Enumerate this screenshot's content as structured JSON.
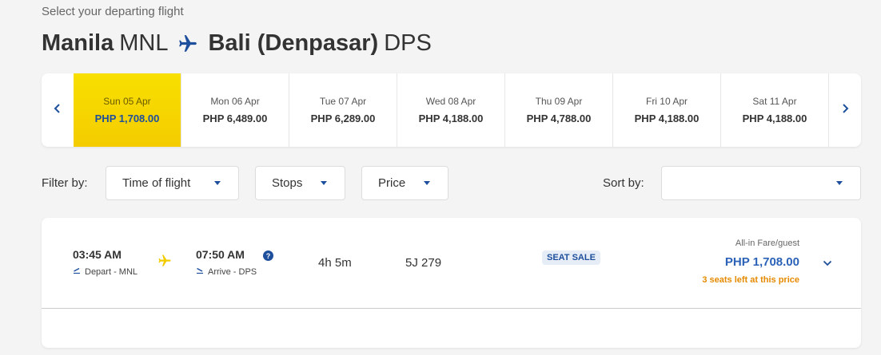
{
  "header": {
    "subtitle": "Select your departing flight",
    "origin_city": "Manila",
    "origin_code": "MNL",
    "dest_city": "Bali (Denpasar)",
    "dest_code": "DPS"
  },
  "dates": [
    {
      "day": "Sun 05 Apr",
      "price": "PHP 1,708.00",
      "selected": true
    },
    {
      "day": "Mon 06 Apr",
      "price": "PHP 6,489.00"
    },
    {
      "day": "Tue 07 Apr",
      "price": "PHP 6,289.00"
    },
    {
      "day": "Wed 08 Apr",
      "price": "PHP 4,188.00"
    },
    {
      "day": "Thu 09 Apr",
      "price": "PHP 4,788.00"
    },
    {
      "day": "Fri 10 Apr",
      "price": "PHP 4,188.00"
    },
    {
      "day": "Sat 11 Apr",
      "price": "PHP 4,188.00"
    }
  ],
  "filters": {
    "label": "Filter by:",
    "time": "Time of flight",
    "stops": "Stops",
    "price": "Price",
    "sort_label": "Sort by:",
    "sort_value": ""
  },
  "flight": {
    "depart_time": "03:45 AM",
    "depart_label": "Depart - MNL",
    "arrive_time": "07:50 AM",
    "arrive_label": "Arrive - DPS",
    "duration": "4h 5m",
    "flight_no": "5J 279",
    "badge": "SEAT SALE",
    "fare_label": "All-in Fare/guest",
    "fare_price": "PHP 1,708.00",
    "seats_left": "3 seats left at this price"
  },
  "colors": {
    "brand_blue": "#1e4f9c",
    "brand_yellow": "#f8d800",
    "warning_orange": "#e58a00"
  }
}
